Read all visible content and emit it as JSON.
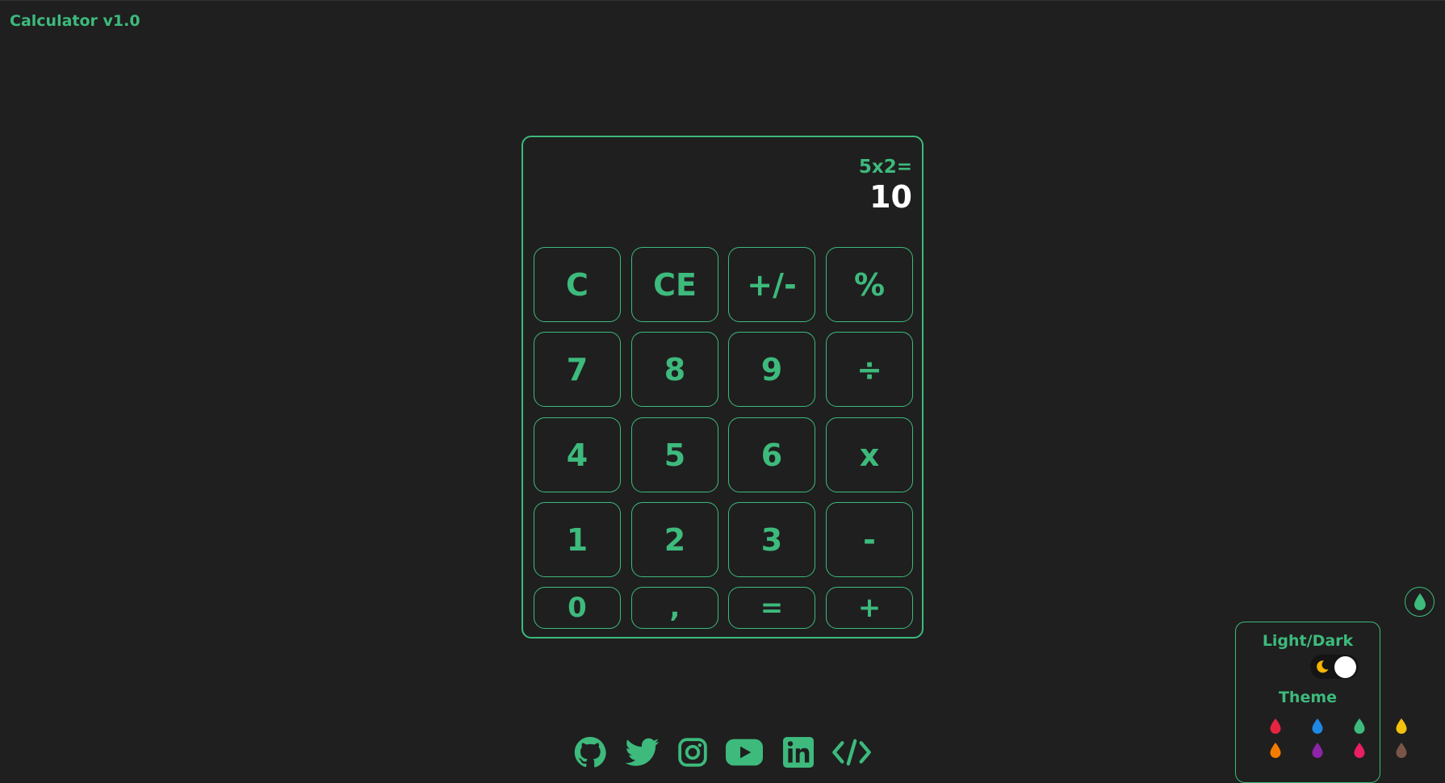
{
  "app": {
    "title": "Calculator v1.0"
  },
  "display": {
    "expression": "5x2=",
    "result": "10"
  },
  "keys": {
    "clear": "C",
    "clear_entry": "CE",
    "sign": "+/-",
    "percent": "%",
    "seven": "7",
    "eight": "8",
    "nine": "9",
    "divide": "÷",
    "four": "4",
    "five": "5",
    "six": "6",
    "multiply": "x",
    "one": "1",
    "two": "2",
    "three": "3",
    "minus": "-",
    "zero": "0",
    "comma": ",",
    "equals": "=",
    "plus": "+"
  },
  "settings": {
    "mode_label": "Light/Dark",
    "theme_label": "Theme",
    "swatches": [
      "red",
      "blue",
      "green",
      "yellow",
      "orange",
      "purple",
      "pink",
      "brown"
    ]
  },
  "colors": {
    "background": "#1f1f1f",
    "accent": "#3dba7c",
    "result_text": "#ffffff",
    "moon": "#f4b400",
    "theme_red": "#e5243f",
    "theme_blue": "#1e88e5",
    "theme_green": "#3dba7c",
    "theme_yellow": "#f4c20d",
    "theme_orange": "#f57c00",
    "theme_purple": "#8e24aa",
    "theme_pink": "#e91e63",
    "theme_brown": "#795548"
  },
  "social_icons": [
    "github-icon",
    "twitter-icon",
    "instagram-icon",
    "youtube-icon",
    "linkedin-icon",
    "code-icon"
  ]
}
